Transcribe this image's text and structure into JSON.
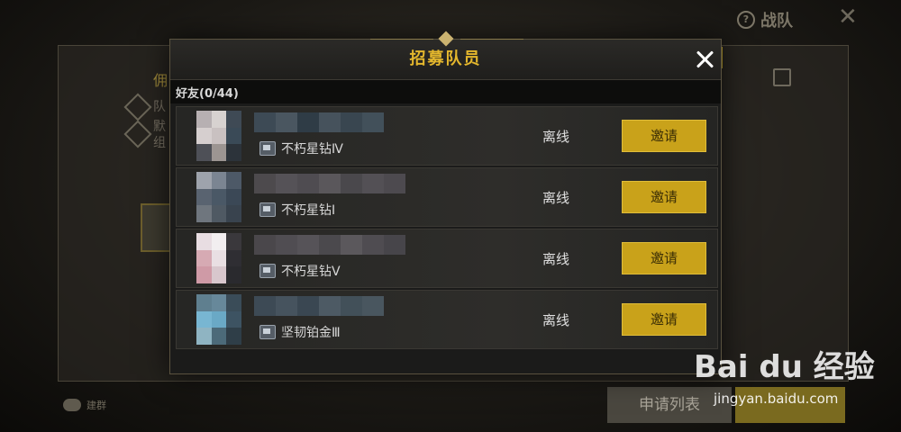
{
  "background": {
    "title": "战队",
    "label_partial": "佣",
    "line1": "队",
    "line2": "默",
    "line3": "组",
    "chat_label": "建群",
    "apply_list_button": "申请列表"
  },
  "modal": {
    "title": "招募队员",
    "friends_header": "好友(0/44)",
    "invite_label": "邀请",
    "friends": [
      {
        "rank": "不朽星钻Ⅳ",
        "status": "离线",
        "avatar": [
          "#b7b0b2",
          "#d7d2d0",
          "#3f4a55",
          "#d6cfcf",
          "#c9c1c1",
          "#3a4a57",
          "#4e5057",
          "#9c9592",
          "#2c333a"
        ],
        "name": [
          "#3d4a55",
          "#4a5660",
          "#2f3c46",
          "#46525c",
          "#394650",
          "#42505a"
        ]
      },
      {
        "rank": "不朽星钻Ⅰ",
        "status": "离线",
        "avatar": [
          "#9ea3ac",
          "#7b8592",
          "#4d5967",
          "#596370",
          "#4a5866",
          "#3b4856",
          "#6f767e",
          "#4f5963",
          "#39434e"
        ],
        "name": [
          "#4d4a4d",
          "#555257",
          "#4f4c51",
          "#5a575b",
          "#4a484c",
          "#535055",
          "#4d4a4f"
        ]
      },
      {
        "rank": "不朽星钻Ⅴ",
        "status": "离线",
        "avatar": [
          "#e8dde2",
          "#f2eef0",
          "#3a383c",
          "#d6aab3",
          "#e9dfe3",
          "#2f2e33",
          "#cf9aa6",
          "#d8c7cd",
          "#2a2a2e"
        ],
        "name": [
          "#4a474b",
          "#504d52",
          "#565358",
          "#4b494d",
          "#5b585c",
          "#4f4c51",
          "#47454a"
        ]
      },
      {
        "rank": "坚韧铂金Ⅲ",
        "status": "离线",
        "avatar": [
          "#5f7f8f",
          "#67889a",
          "#3a4c58",
          "#78b6d2",
          "#6aa9c6",
          "#3d5362",
          "#8fb4c2",
          "#4c6a79",
          "#2f3e48"
        ],
        "name": [
          "#3d4a55",
          "#46535e",
          "#3a4752",
          "#4d5a64",
          "#425059",
          "#49565f"
        ]
      }
    ]
  },
  "watermark": {
    "logo": "Bai du 经验",
    "url": "jingyan.baidu.com"
  }
}
